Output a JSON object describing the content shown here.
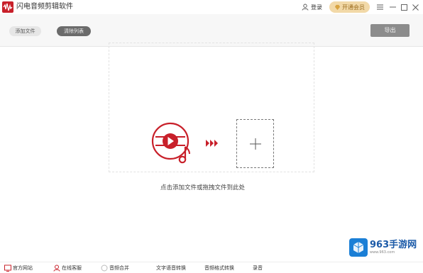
{
  "app": {
    "title": "闪电音频剪辑软件",
    "brand_color": "#c8202a"
  },
  "header": {
    "login_label": "登录",
    "vip_label": "开通会员",
    "minimize_icon": "minimize-icon",
    "maximize_icon": "maximize-icon",
    "close_icon": "close-icon",
    "menu_icon": "menu-icon"
  },
  "toolbar": {
    "add_file_label": "添加文件",
    "clear_list_label": "清除列表",
    "export_label": "导出"
  },
  "main": {
    "drop_hint": "点击添加文件或拖拽文件到此处",
    "music_icon": "music-disc-icon",
    "arrow_icon": "triple-arrow-icon",
    "add_icon": "plus-icon"
  },
  "bottom": {
    "items": [
      {
        "label": "官方网站",
        "icon": "website-icon"
      },
      {
        "label": "在线客服",
        "icon": "support-icon"
      },
      {
        "label": "音频合并",
        "icon": "merge-icon"
      },
      {
        "label": "文字语音转换",
        "icon": ""
      },
      {
        "label": "音频格式转换",
        "icon": ""
      },
      {
        "label": "录音",
        "icon": ""
      }
    ]
  },
  "watermark": {
    "title": "963手游网",
    "subtitle": "www.963.com"
  },
  "colors": {
    "accent": "#c8202a",
    "vip_bg": "#f2d9a8",
    "export_bg": "#8c8c8c",
    "watermark_blue": "#1b7fd6"
  }
}
